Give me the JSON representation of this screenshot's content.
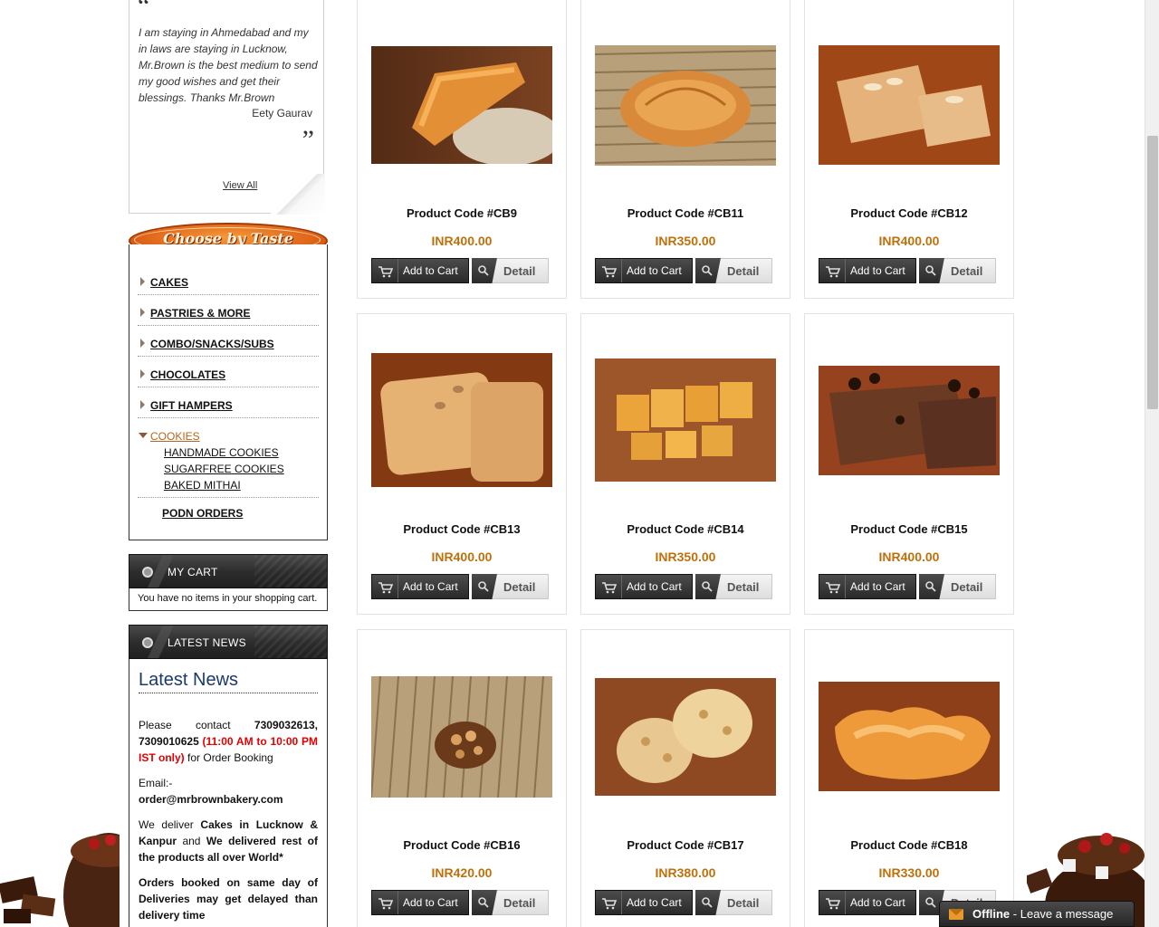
{
  "testimonial": {
    "text": "I am staying in Ahmedabad and my in laws are staying in Lucknow, Mr.Brown is the best medium to send my good wishes and get their blessings. Thanks Mr.Brown",
    "author": "Eety Gaurav",
    "view_all": "View All"
  },
  "taste": {
    "title": "Choose by Taste",
    "categories": [
      "CAKES",
      "PASTRIES & MORE",
      "COMBO/SNACKS/SUBS",
      "CHOCOLATES",
      "GIFT HAMPERS",
      "COOKIES"
    ],
    "subcategories": [
      "HANDMADE COOKIES",
      "SUGARFREE COOKIES",
      "BAKED MITHAI"
    ],
    "podn": "PODN ORDERS"
  },
  "cart": {
    "title": "MY CART",
    "empty_text": "You have no items in your shopping cart."
  },
  "news": {
    "title": "LATEST NEWS",
    "heading": "Latest News",
    "contact_prefix": "Please contact",
    "phones": "7309032613, 7309010625",
    "hours": "(11:00 AM to 10:00 PM IST only)",
    "contact_suffix": "for Order Booking",
    "email_label": "Email:-",
    "email": "order@mrbrownbakery.com",
    "deliver_1": "We deliver",
    "deliver_cities": "Cakes in Lucknow & Kanpur",
    "deliver_2": "and",
    "deliver_rest": "We delivered rest of the products all over World*",
    "orders_note": "Orders booked on same day of Deliveries may get delayed than delivery time"
  },
  "buttons": {
    "add_to_cart": "Add to Cart",
    "detail": "Detail"
  },
  "products": [
    {
      "title": "Product Code #CB9",
      "price": "INR400.00"
    },
    {
      "title": "Product Code #CB11",
      "price": "INR350.00"
    },
    {
      "title": "Product Code #CB12",
      "price": "INR400.00"
    },
    {
      "title": "Product Code #CB13",
      "price": "INR400.00"
    },
    {
      "title": "Product Code #CB14",
      "price": "INR350.00"
    },
    {
      "title": "Product Code #CB15",
      "price": "INR400.00"
    },
    {
      "title": "Product Code #CB16",
      "price": "INR420.00"
    },
    {
      "title": "Product Code #CB17",
      "price": "INR380.00"
    },
    {
      "title": "Product Code #CB18",
      "price": "INR330.00"
    }
  ],
  "chat": {
    "status": "Offline",
    "message": "- Leave a message"
  },
  "colors": {
    "price": "#c0700a",
    "active_category": "#b5651d",
    "news_heading": "#1a3a6a",
    "hours_red": "#e00000",
    "taste_orange": "#e0661a"
  }
}
